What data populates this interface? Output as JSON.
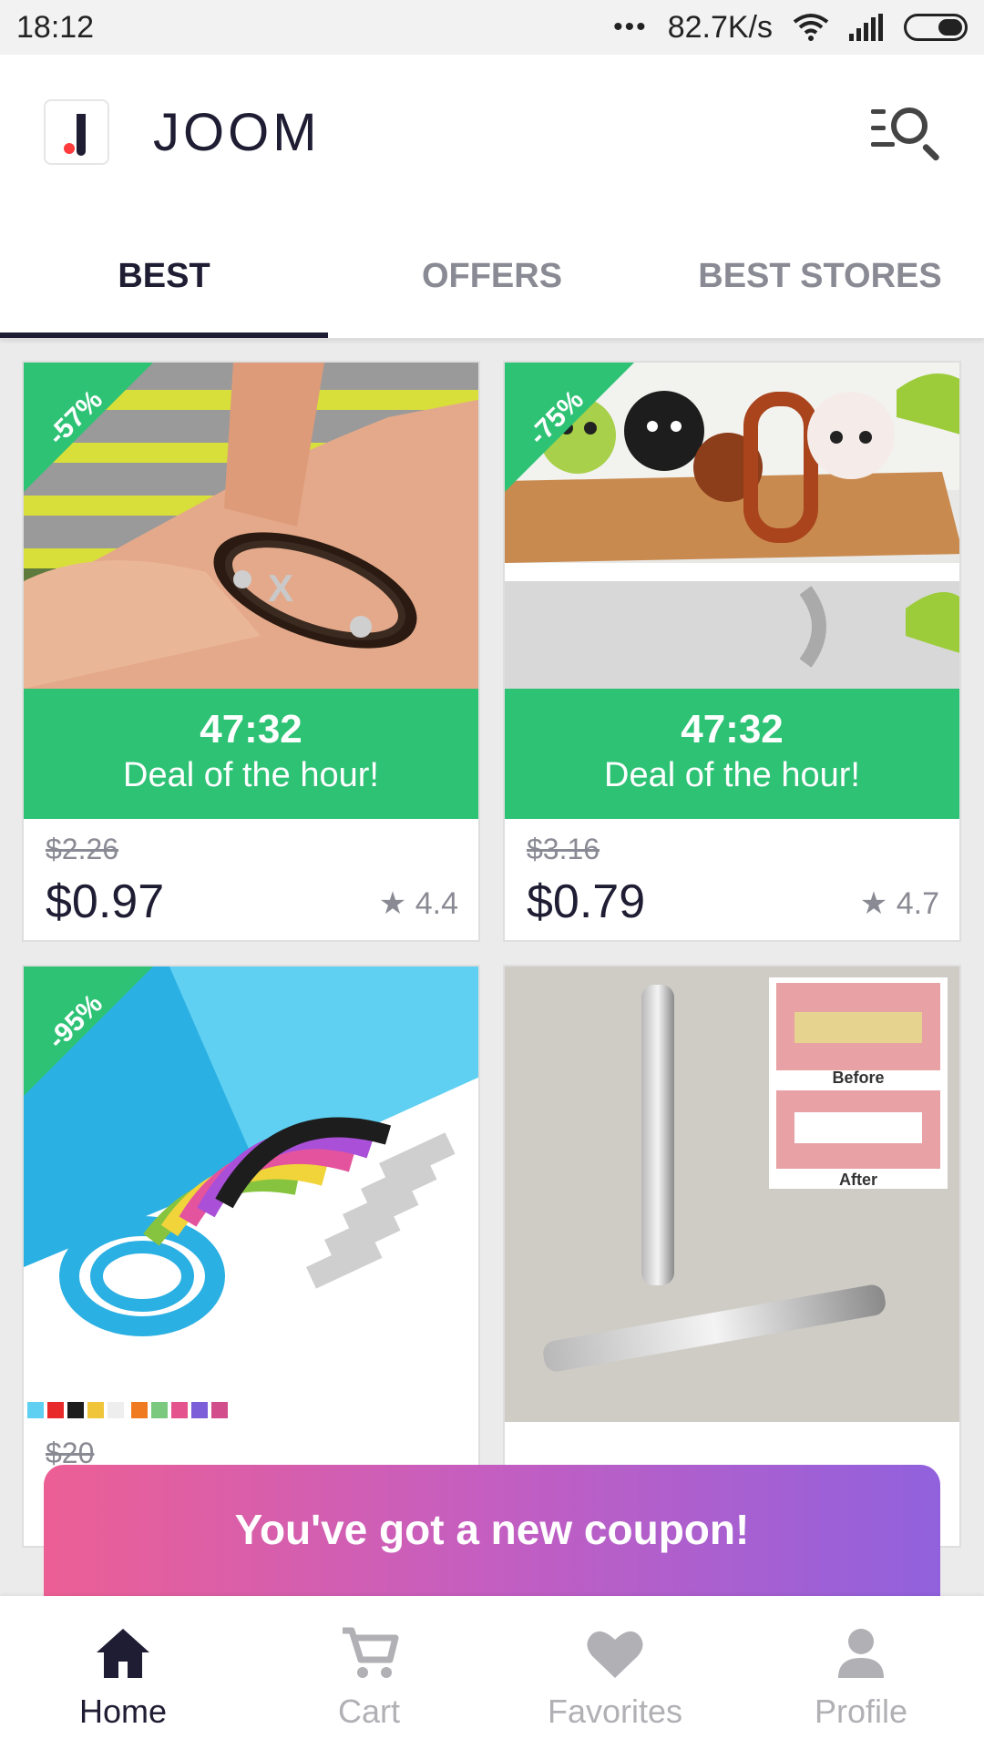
{
  "status_bar": {
    "time": "18:12",
    "dots": "•••",
    "speed": "82.7K/s"
  },
  "header": {
    "brand": "JOOM",
    "logo_icon": "joom-logo",
    "menu_icon": "search-menu-icon"
  },
  "tabs": [
    {
      "label": "BEST",
      "active": true
    },
    {
      "label": "OFFERS",
      "active": false
    },
    {
      "label": "BEST STORES",
      "active": false
    }
  ],
  "products": [
    {
      "discount": "-57%",
      "timer": "47:32",
      "deal_label": "Deal of the hour!",
      "old_price": "$2.26",
      "price": "$0.97",
      "rating": "4.4"
    },
    {
      "discount": "-75%",
      "timer": "47:32",
      "deal_label": "Deal of the hour!",
      "old_price": "$3.16",
      "price": "$0.79",
      "rating": "4.7"
    },
    {
      "discount": "-95%",
      "old_price": "$20"
    },
    {
      "before_label": "Before",
      "after_label": "After"
    }
  ],
  "coupon": {
    "text": "You've got a new coupon!"
  },
  "bottom_nav": [
    {
      "label": "Home",
      "icon": "home-icon",
      "active": true
    },
    {
      "label": "Cart",
      "icon": "cart-icon",
      "active": false
    },
    {
      "label": "Favorites",
      "icon": "heart-icon",
      "active": false
    },
    {
      "label": "Profile",
      "icon": "profile-icon",
      "active": false
    }
  ],
  "colors": {
    "accent_green": "#2ec275",
    "dark": "#1f1d33",
    "inactive": "#8a8a94"
  }
}
